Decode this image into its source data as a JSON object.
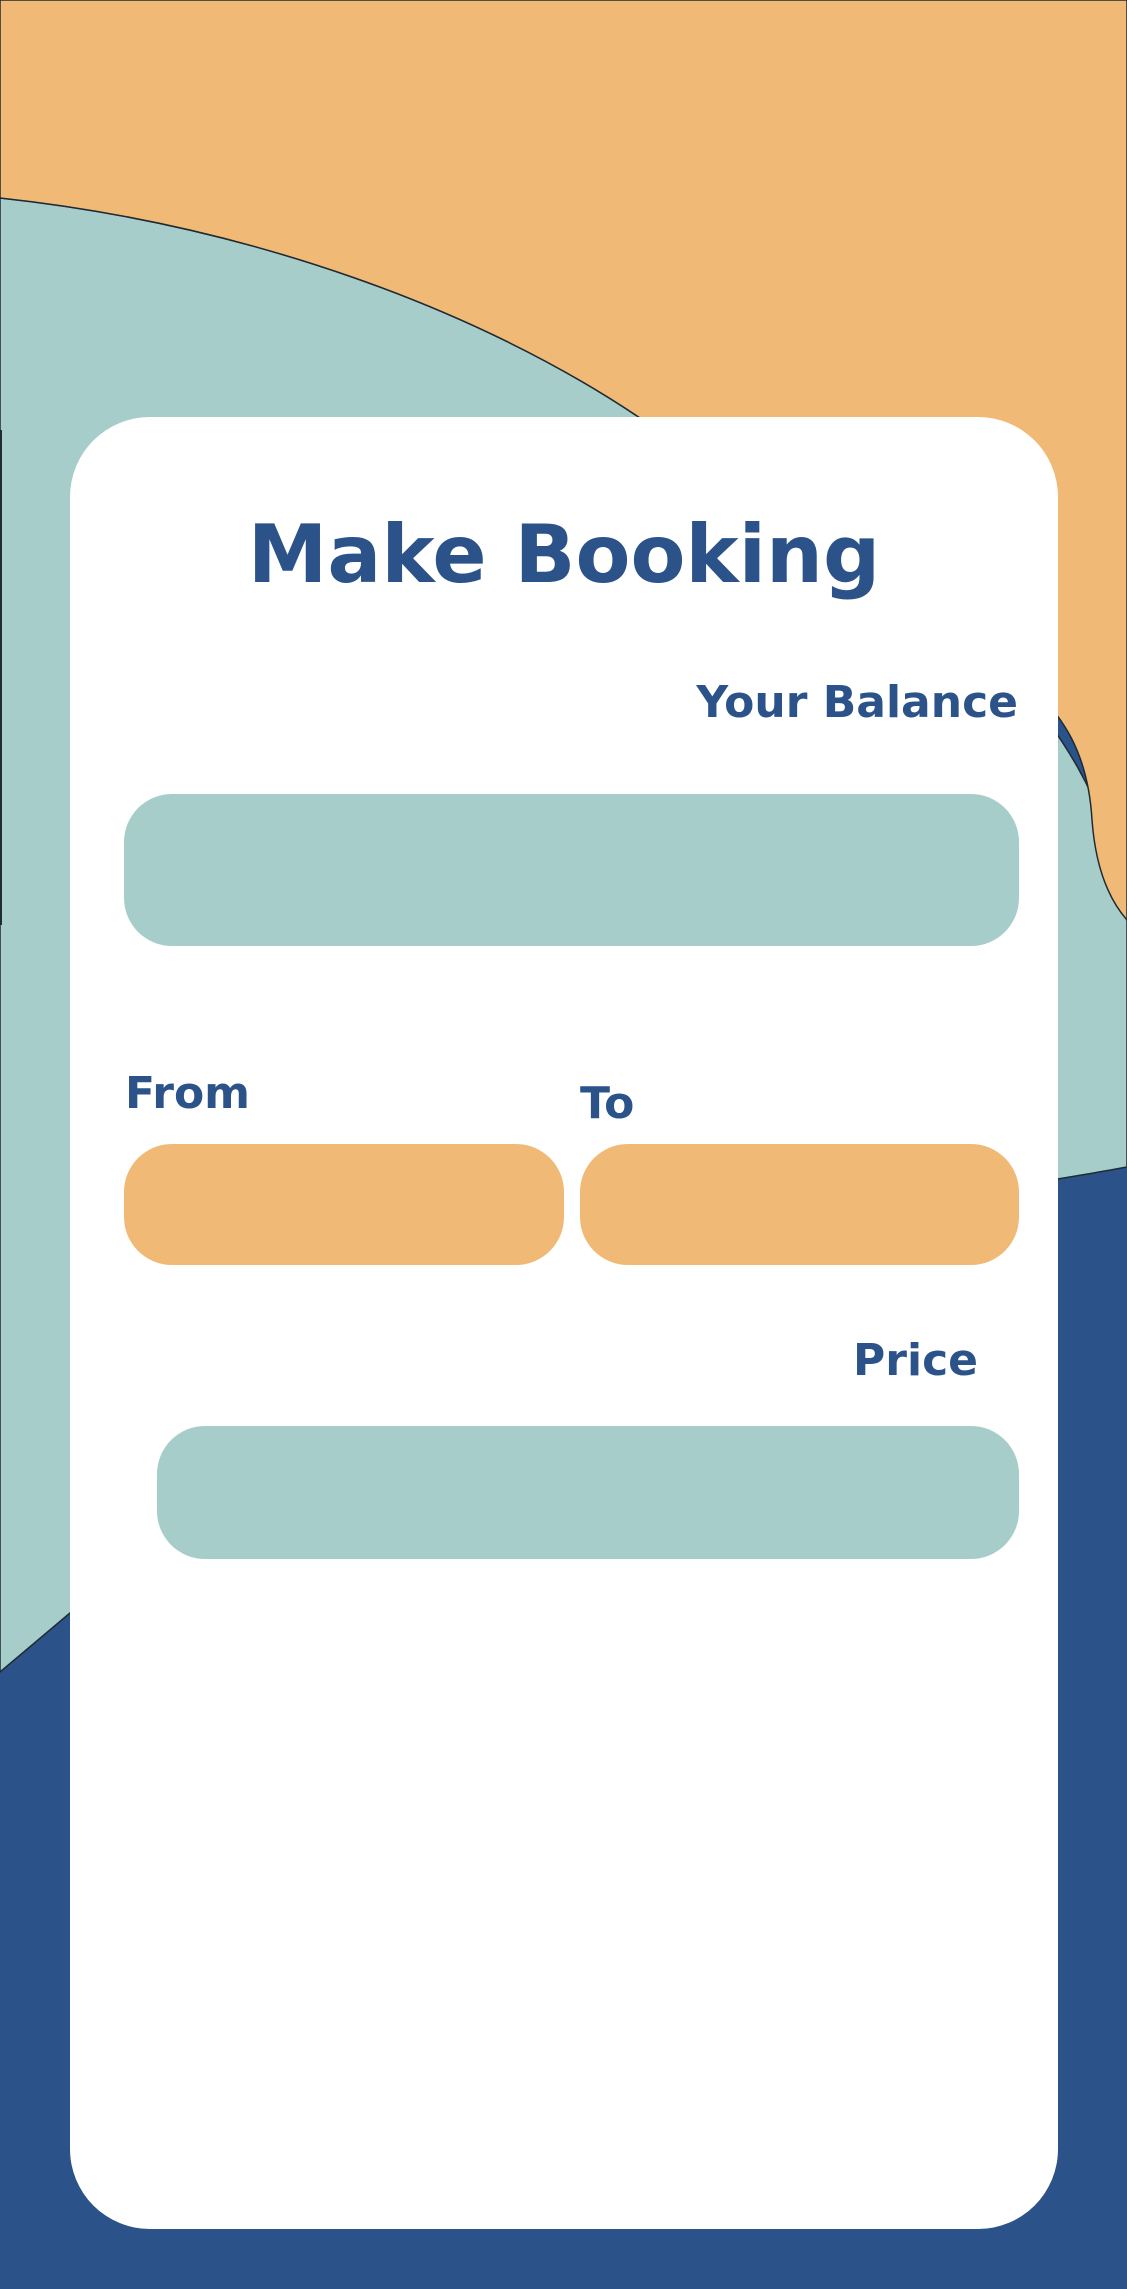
{
  "screen": {
    "title": "Make Booking",
    "balance_label": "Your Balance",
    "balance_value": "",
    "from_label": "From",
    "from_value": "",
    "to_label": "To",
    "to_value": "",
    "price_label": "Price",
    "price_value": ""
  },
  "colors": {
    "orange": "#F0B976",
    "teal": "#A7CDCA",
    "navy": "#2B5389",
    "white": "#FFFFFF",
    "outline": "#1F2A33"
  }
}
